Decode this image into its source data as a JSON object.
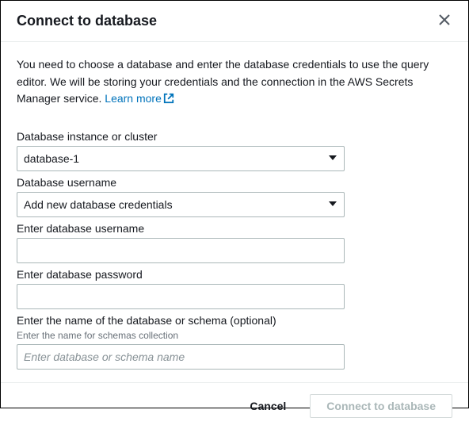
{
  "header": {
    "title": "Connect to database"
  },
  "description": {
    "text": "You need to choose a database and enter the database credentials to use the query editor. We will be storing your credentials and the connection in the AWS Secrets Manager service. ",
    "link_text": "Learn more"
  },
  "form": {
    "instance": {
      "label": "Database instance or cluster",
      "value": "database-1"
    },
    "username_select": {
      "label": "Database username",
      "value": "Add new database credentials"
    },
    "username_input": {
      "label": "Enter database username",
      "value": ""
    },
    "password": {
      "label": "Enter database password",
      "value": ""
    },
    "dbname": {
      "label": "Enter the name of the database or schema (optional)",
      "hint": "Enter the name for schemas collection",
      "placeholder": "Enter database or schema name",
      "value": ""
    }
  },
  "footer": {
    "cancel": "Cancel",
    "submit": "Connect to database"
  }
}
